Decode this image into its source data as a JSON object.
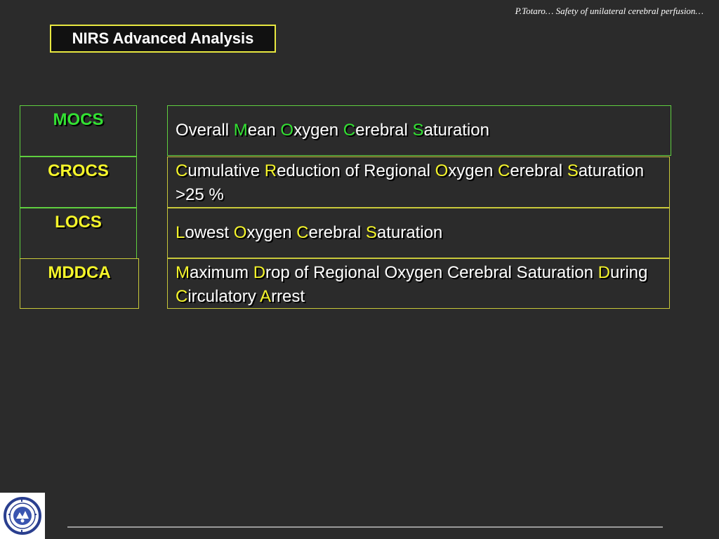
{
  "header": {
    "credit": "P.Totaro… Safety of unilateral cerebral perfusion…"
  },
  "title": "NIRS Advanced Analysis",
  "colors": {
    "green": "#33e033",
    "yellow": "#f5f52a",
    "green_border": "#5fcf3f",
    "yellow_border": "#c8c83a"
  },
  "rows": [
    {
      "abbr": "MOCS",
      "desc": [
        {
          "t": "Overall ",
          "h": false
        },
        {
          "t": "M",
          "h": true
        },
        {
          "t": "ean ",
          "h": false
        },
        {
          "t": "O",
          "h": true
        },
        {
          "t": "xygen ",
          "h": false
        },
        {
          "t": "C",
          "h": true
        },
        {
          "t": "erebral ",
          "h": false
        },
        {
          "t": "S",
          "h": true
        },
        {
          "t": "aturation",
          "h": false
        }
      ]
    },
    {
      "abbr": "CROCS",
      "desc": [
        {
          "t": "C",
          "h": true
        },
        {
          "t": "umulative ",
          "h": false
        },
        {
          "t": "R",
          "h": true
        },
        {
          "t": "eduction of  Regional ",
          "h": false
        },
        {
          "t": "O",
          "h": true
        },
        {
          "t": "xygen ",
          "h": false
        },
        {
          "t": "C",
          "h": true
        },
        {
          "t": "erebral ",
          "h": false
        },
        {
          "t": "S",
          "h": true
        },
        {
          "t": "aturation >25 %",
          "h": false
        }
      ]
    },
    {
      "abbr": "LOCS",
      "desc": [
        {
          "t": "L",
          "h": true
        },
        {
          "t": "owest ",
          "h": false
        },
        {
          "t": "O",
          "h": true
        },
        {
          "t": "xygen ",
          "h": false
        },
        {
          "t": "C",
          "h": true
        },
        {
          "t": "erebral ",
          "h": false
        },
        {
          "t": "S",
          "h": true
        },
        {
          "t": "aturation",
          "h": false
        }
      ]
    },
    {
      "abbr": "MDDCA",
      "desc": [
        {
          "t": "M",
          "h": true
        },
        {
          "t": "aximum ",
          "h": false
        },
        {
          "t": "D",
          "h": true
        },
        {
          "t": "rop of Regional Oxygen Cerebral Saturation ",
          "h": false
        },
        {
          "t": "D",
          "h": true
        },
        {
          "t": "uring ",
          "h": false
        },
        {
          "t": "C",
          "h": true
        },
        {
          "t": "irculatory ",
          "h": false
        },
        {
          "t": "A",
          "h": true
        },
        {
          "t": "rrest",
          "h": false
        }
      ]
    }
  ],
  "logo_icon": "university-seal-icon"
}
